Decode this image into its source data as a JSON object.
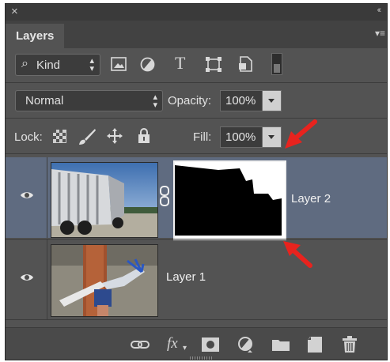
{
  "window": {
    "close_glyph": "×",
    "collapse_glyph": "‹‹"
  },
  "panel": {
    "tab_label": "Layers",
    "menu_glyph": "▾≡"
  },
  "filter": {
    "kind_label": "Kind",
    "icons": [
      "image-filter-icon",
      "adjustment-filter-icon",
      "type-filter-icon",
      "shape-filter-icon",
      "smart-object-filter-icon"
    ]
  },
  "blend": {
    "mode": "Normal",
    "opacity_label": "Opacity:",
    "opacity_value": "100%"
  },
  "lock": {
    "label": "Lock:",
    "fill_label": "Fill:",
    "fill_value": "100%"
  },
  "layers": [
    {
      "name": "Layer 2",
      "selected": true,
      "visible": true,
      "has_mask": true,
      "linked": true
    },
    {
      "name": "Layer 1",
      "selected": false,
      "visible": true,
      "has_mask": false
    }
  ],
  "bottom_icons": [
    "link-layers-icon",
    "fx-icon",
    "add-mask-icon",
    "adjustment-layer-icon",
    "new-group-icon",
    "new-layer-icon",
    "trash-icon"
  ],
  "fx_label": "fx",
  "colors": {
    "panel_bg": "#535353",
    "selected_row": "#5f6b80",
    "annotation_arrow": "#e8231e"
  }
}
